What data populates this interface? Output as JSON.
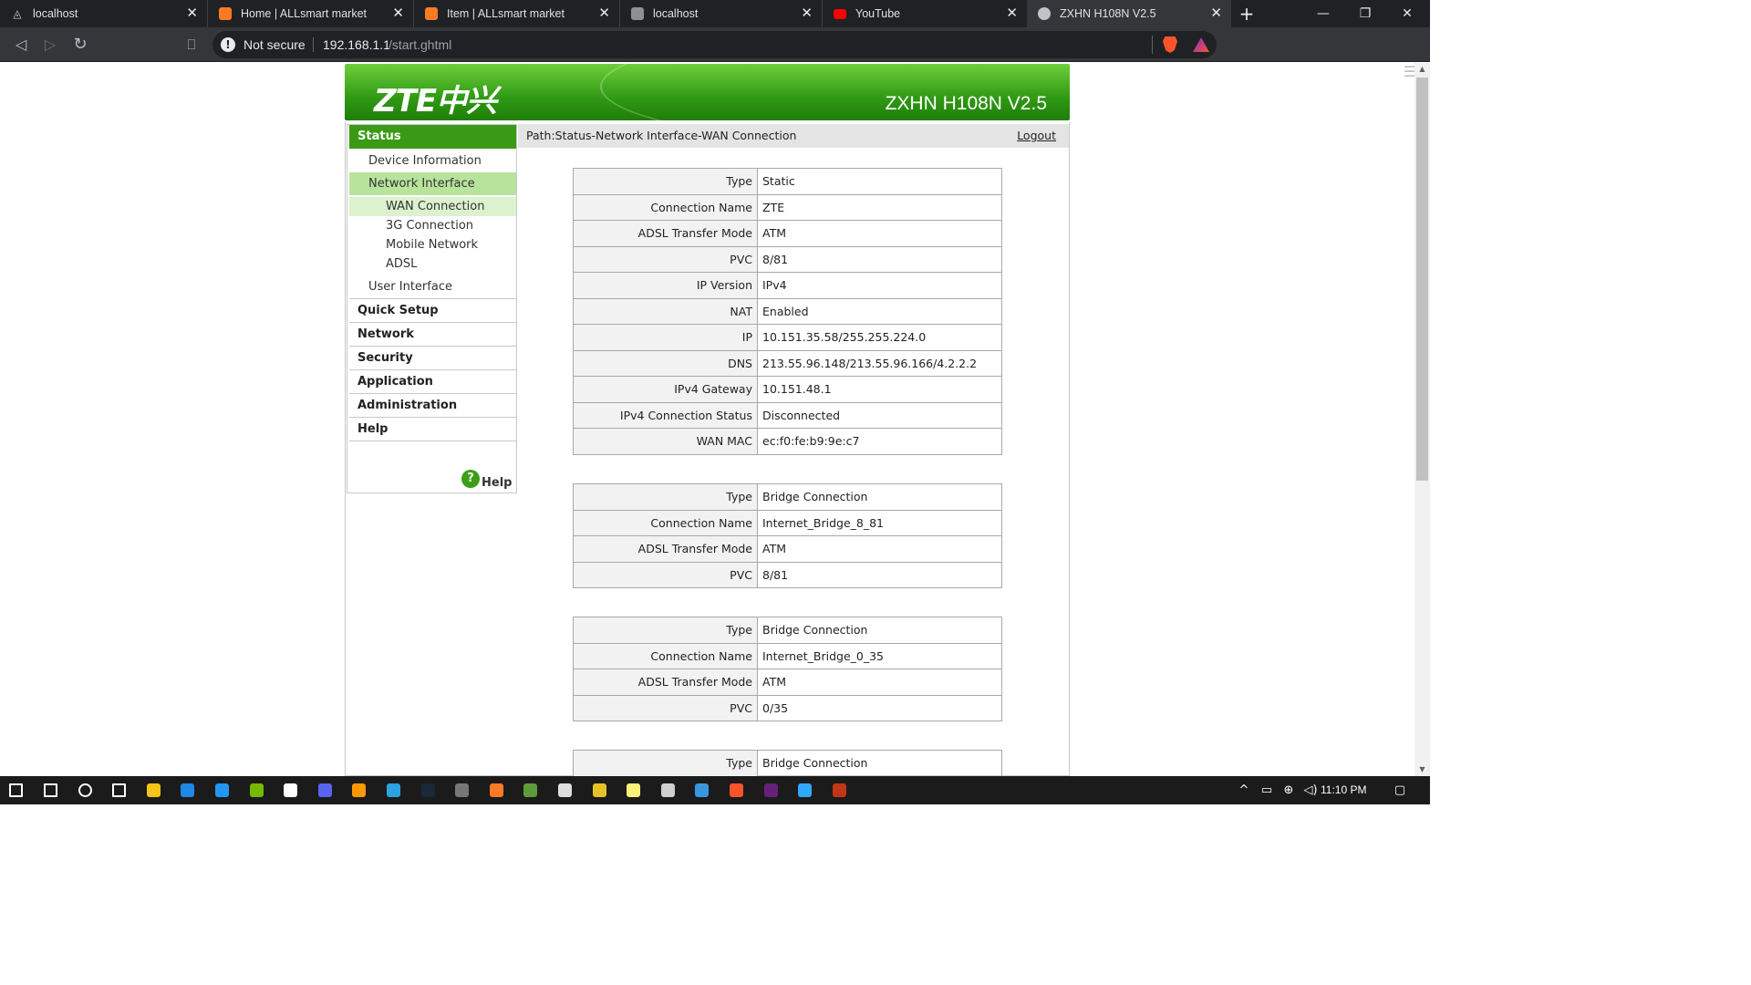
{
  "browser": {
    "tabs": [
      {
        "title": "localhost",
        "icon": "localhost-app-icon"
      },
      {
        "title": "Home | ALLsmart market",
        "icon": "xampp-icon"
      },
      {
        "title": "Item | ALLsmart market",
        "icon": "xampp-icon"
      },
      {
        "title": "localhost",
        "icon": "localhost-icon"
      },
      {
        "title": "YouTube",
        "icon": "youtube-icon"
      },
      {
        "title": "ZXHN H108N V2.5",
        "icon": "globe-icon",
        "active": true
      }
    ],
    "new_tab_glyph": "+",
    "close_glyph": "✕",
    "window_controls": {
      "minimize": "—",
      "restore": "❐",
      "close": "✕"
    },
    "security_label": "Not secure",
    "url_host": "192.168.1.1",
    "url_path": "/start.ghtml"
  },
  "router": {
    "logo": "ZTE中兴",
    "model": "ZXHN H108N V2.5",
    "path": "Path:Status-Network Interface-WAN Connection",
    "logout": "Logout",
    "nav": {
      "status": "Status",
      "device_information": "Device Information",
      "network_interface": "Network Interface",
      "wan_connection": "WAN Connection",
      "g3_connection": "3G Connection",
      "mobile_network": "Mobile Network",
      "adsl": "ADSL",
      "user_interface": "User Interface",
      "quick_setup": "Quick Setup",
      "network": "Network",
      "security": "Security",
      "application": "Application",
      "administration": "Administration",
      "help": "Help"
    },
    "help_label": "Help",
    "connections": [
      {
        "rows": [
          {
            "label": "Type",
            "value": "Static"
          },
          {
            "label": "Connection Name",
            "value": "ZTE"
          },
          {
            "label": "ADSL Transfer Mode",
            "value": "ATM"
          },
          {
            "label": "PVC",
            "value": "8/81"
          },
          {
            "label": "IP Version",
            "value": "IPv4"
          },
          {
            "label": "NAT",
            "value": "Enabled"
          },
          {
            "label": "IP",
            "value": "10.151.35.58/255.255.224.0"
          },
          {
            "label": "DNS",
            "value": "213.55.96.148/213.55.96.166/4.2.2.2"
          },
          {
            "label": "IPv4 Gateway",
            "value": "10.151.48.1"
          },
          {
            "label": "IPv4 Connection Status",
            "value": "Disconnected"
          },
          {
            "label": "WAN MAC",
            "value": "ec:f0:fe:b9:9e:c7"
          }
        ]
      },
      {
        "rows": [
          {
            "label": "Type",
            "value": "Bridge Connection"
          },
          {
            "label": "Connection Name",
            "value": "Internet_Bridge_8_81"
          },
          {
            "label": "ADSL Transfer Mode",
            "value": "ATM"
          },
          {
            "label": "PVC",
            "value": "8/81"
          }
        ]
      },
      {
        "rows": [
          {
            "label": "Type",
            "value": "Bridge Connection"
          },
          {
            "label": "Connection Name",
            "value": "Internet_Bridge_0_35"
          },
          {
            "label": "ADSL Transfer Mode",
            "value": "ATM"
          },
          {
            "label": "PVC",
            "value": "0/35"
          }
        ]
      },
      {
        "rows": [
          {
            "label": "Type",
            "value": "Bridge Connection"
          }
        ]
      }
    ]
  },
  "taskbar": {
    "clock": "11:10 PM",
    "apps": [
      "windows-start-icon",
      "search-icon",
      "cortana-icon",
      "task-view-icon",
      "file-explorer-icon",
      "media-player-icon",
      "browser-app-icon",
      "nvidia-icon",
      "mail-icon",
      "discord-icon",
      "sublime-text-icon",
      "telegram-icon",
      "steam-icon",
      "archive-icon",
      "xampp-icon",
      "minecraft-icon",
      "obs-icon",
      "folder-icon",
      "sticky-notes-icon",
      "calculator-icon",
      "app-l-icon",
      "brave-icon",
      "visual-studio-icon",
      "photoshop-icon",
      "dota-icon"
    ],
    "colors": {
      "accent": "#3a9a15",
      "banner": "#2f9a14"
    }
  }
}
